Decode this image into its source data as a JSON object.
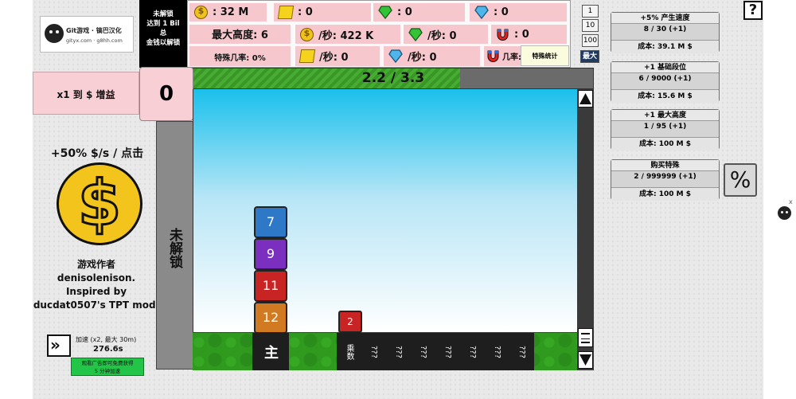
{
  "logo": {
    "brand": "Git游戏 · 镐巴汉化",
    "domains": "gityx.com · g8hh.com"
  },
  "locked_notice": {
    "line1": "未解锁",
    "line2": "达到 1 Bil",
    "line3": "总",
    "line4": "金钱以解锁"
  },
  "stats": {
    "money": ": 32 M",
    "gold": ": 0",
    "emerald": ": 0",
    "diamond": ": 0",
    "max_height": "最大高度: 6",
    "money_per_sec": "/秒: 422 K",
    "emerald_per_sec": "/秒: 0",
    "magnet": ": 0",
    "special_chance": "特殊几率: 0%",
    "gold_per_sec": "/秒: 0",
    "diamond_per_sec": "/秒: 0",
    "magnet_chance": "几率: 0%",
    "special_stats_btn": "特殊统计"
  },
  "buy_amounts": [
    "1",
    "10",
    "100",
    "最大"
  ],
  "progress": {
    "label": "2.2 / 3.3",
    "fraction": 0.667
  },
  "gain_panel": {
    "label": "x1 到 $ 增益",
    "value": "0"
  },
  "click_panel": {
    "title": "+50% $/s / 点击"
  },
  "credits": {
    "line1": "游戏作者",
    "line2": "denisolenison.",
    "line3": "Inspired by",
    "line4": "ducdat0507's TPT mod."
  },
  "speed": {
    "label": "加速 (x2, 最大 30m)",
    "time": "276.6s",
    "ad_line1": "观看广告即可免费获得",
    "ad_line2": "5 分钟加速"
  },
  "left_locked": "未解锁",
  "blocks": [
    {
      "value": "7",
      "color": "#2e78c8"
    },
    {
      "value": "9",
      "color": "#7b2fbf"
    },
    {
      "value": "11",
      "color": "#c82424"
    },
    {
      "value": "12",
      "color": "#d17a22"
    }
  ],
  "falling_block": {
    "value": "2",
    "color": "#c82424"
  },
  "base_slot": "主",
  "multiplier_slot": "乘数",
  "locked_slots": [
    "???",
    "???",
    "???",
    "???",
    "???",
    "???",
    "???"
  ],
  "upgrades": [
    {
      "title": "+5% 产生速度",
      "level": "8 / 30 (+1)",
      "cost": "成本: 39.1 M $"
    },
    {
      "title": "+1 基础段位",
      "level": "6 / 9000 (+1)",
      "cost": "成本: 15.6 M $"
    },
    {
      "title": "+1 最大高度",
      "level": "1 / 95 (+1)",
      "cost": "成本: 100 M $"
    },
    {
      "title": "购买特殊",
      "level": "2 / 999999 (+1)",
      "cost": "成本: 100 M $"
    }
  ],
  "percent_btn": "%",
  "help_btn": "?",
  "close_mark": "x"
}
